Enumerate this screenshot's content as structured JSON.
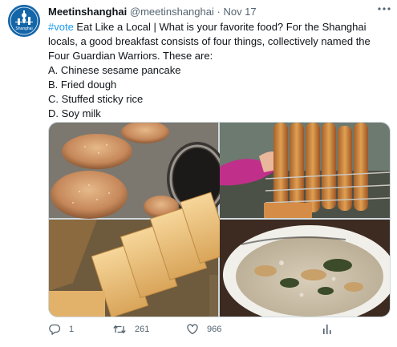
{
  "tweet": {
    "author_name": "Meetinshanghai",
    "handle": "@meetinshanghai",
    "separator": "·",
    "date": "Nov 17",
    "avatar_text": "Shanghai",
    "hashtag": "#vote",
    "body_after_hashtag": " Eat Like a Local | What is your favorite food? For the Shanghai locals, a good breakfast consists of four things, collectively named the Four Guardian Warriors. These are:",
    "options": [
      "A. Chinese sesame pancake",
      "B. Fried dough",
      "C. Stuffed sticky rice",
      "D. Soy milk"
    ]
  },
  "images": [
    {
      "subject": "sesame-pancakes-on-oven"
    },
    {
      "subject": "fried-dough-sticks-on-rack"
    },
    {
      "subject": "stuffed-sticky-rice"
    },
    {
      "subject": "soy-milk-bowl"
    }
  ],
  "actions": {
    "reply_count": "1",
    "retweet_count": "261",
    "like_count": "966"
  },
  "colors": {
    "link": "#1d9bf0",
    "secondary_text": "#536471",
    "avatar_bg": "#1466a8"
  },
  "icons": [
    "more-icon",
    "reply-icon",
    "retweet-icon",
    "like-icon",
    "analytics-icon"
  ]
}
